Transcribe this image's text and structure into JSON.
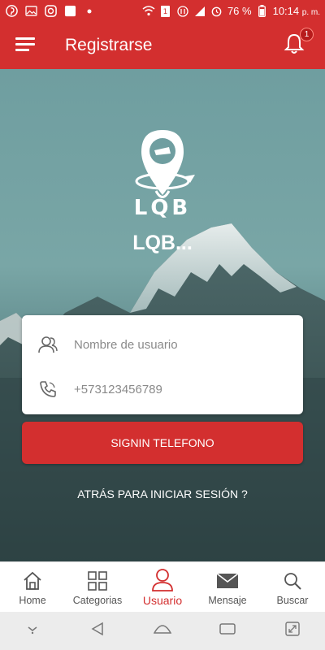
{
  "status_bar": {
    "battery": "76 %",
    "time": "10:14",
    "time_suffix": "p. m.",
    "notification_count": "1"
  },
  "app_bar": {
    "title": "Registrarse",
    "bell_badge": "1"
  },
  "hero": {
    "logo_text": "LQB",
    "brand_name": "LQB..."
  },
  "form": {
    "username_placeholder": "Nombre de usuario",
    "phone_placeholder": "+573123456789"
  },
  "signin_label": "SIGNIN TELEFONO",
  "back_link": "ATRÁS PARA INICIAR SESIÓN ?",
  "bottom_nav": {
    "items": [
      {
        "label": "Home",
        "icon": "home-icon"
      },
      {
        "label": "Categorias",
        "icon": "grid-icon"
      },
      {
        "label": "Usuario",
        "icon": "user-icon",
        "active": true
      },
      {
        "label": "Mensaje",
        "icon": "mail-icon"
      },
      {
        "label": "Buscar",
        "icon": "search-icon"
      }
    ]
  },
  "colors": {
    "primary": "#d32f2f",
    "active": "#d32f2f",
    "inactive": "#555555"
  }
}
